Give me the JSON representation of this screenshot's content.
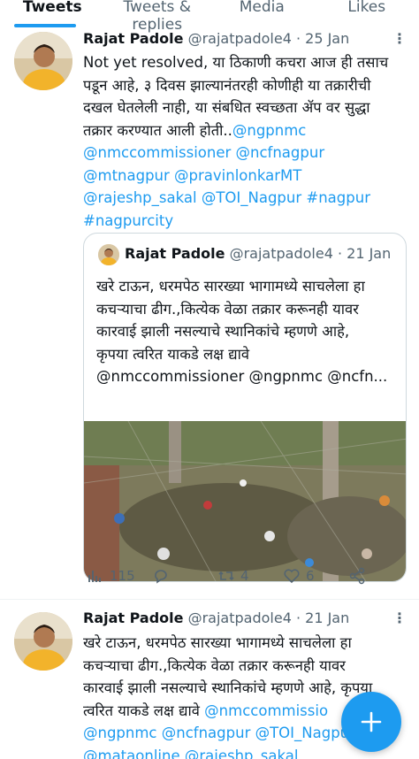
{
  "tabs": [
    {
      "label": "Tweets",
      "active": true
    },
    {
      "label": "Tweets & replies",
      "active": false
    },
    {
      "label": "Media",
      "active": false
    },
    {
      "label": "Likes",
      "active": false
    }
  ],
  "tweet1": {
    "name": "Rajat Padole",
    "handle": "@rajatpadole4",
    "date": "· 25 Jan",
    "text_lines": [
      "Not yet resolved, या ठिकाणी कचरा आज ही तसाच",
      "पडून आहे, ३ दिवस झाल्यानंतरही कोणीही या तक्रारीची",
      "दखल घेतलेली नाही, या संबधित स्वच्छता ॲप वर सुद्धा",
      "तक्रार करण्यात आली होती.."
    ],
    "mention_inline": "@ngpnmc",
    "mention_lines": [
      "@nmccommissioner @ncfnagpur",
      "@mtnagpur @pravinlonkarMT",
      "@rajeshp_sakal @TOI_Nagpur #nagpur",
      "#nagpurcity"
    ],
    "quote": {
      "name": "Rajat Padole",
      "handle": "@rajatpadole4",
      "date": "· 21 Jan",
      "text_lines": [
        "खरे टाऊन, धरमपेठ सारख्या भागामध्ये साचलेला हा",
        "कचऱ्याचा ढीग.,कित्येक वेळा तक्रार करूनही यावर",
        "कारवाई झाली नसल्याचे स्थानिकांचे म्हणणे आहे,",
        "कृपया त्वरित याकडे लक्ष द्यावे"
      ],
      "mentions": "@nmccommissioner @ngpnmc @ncfn..."
    },
    "actions": {
      "views": "115",
      "replies": "",
      "retweets": "4",
      "likes": "6"
    }
  },
  "tweet2": {
    "name": "Rajat Padole",
    "handle": "@rajatpadole4",
    "date": "· 21 Jan",
    "text_lines": [
      "खरे टाऊन, धरमपेठ सारख्या भागामध्ये साचलेला हा",
      "कचऱ्याचा ढीग.,कित्येक वेळा तक्रार करूनही यावर",
      "कारवाई झाली नसल्याचे स्थानिकांचे म्हणणे आहे, कृपया"
    ],
    "line4_text": "त्वरित याकडे लक्ष द्यावे",
    "line4_mention": "@nmccommissio",
    "mention_lines": [
      "@ngpnmc @ncfnagpur @TOI_Nagpu",
      "@mataonline @rajeshp_sakal"
    ]
  },
  "fab_label": "+",
  "colors": {
    "accent": "#1d9bf0",
    "text": "#0f1419",
    "secondary": "#536471",
    "border": "#cfd9de"
  }
}
